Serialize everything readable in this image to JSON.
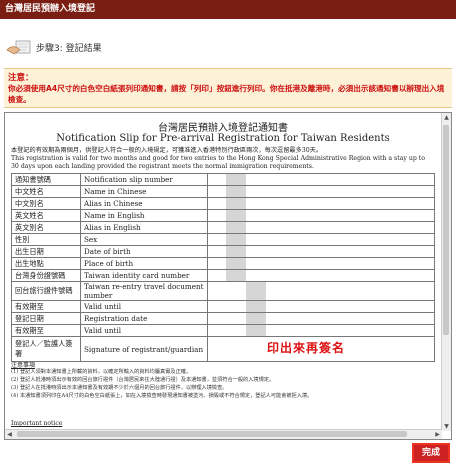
{
  "header": {
    "title": "台灣居民預辦入境登記"
  },
  "step": {
    "label": "步驟3: 登記結果"
  },
  "notice": {
    "title": "注意：",
    "text": "你必須使用A4尺寸的白色空白紙張列印通知書，請按「列印」按鈕進行列印。你在抵港及離港時，必須出示該通知書以辦理出入境檢查。"
  },
  "slip": {
    "title_cn": "台灣居民預辦入境登記通知書",
    "title_en": "Notification Slip for Pre-arrival Registration for Taiwan Residents",
    "intro_cn": "本登記的有效期為兩個月，供登記人符合一般的入境規定，可獲准進入香港特別行政區兩次，每次逗留最多30天。",
    "intro_en": "This registration is valid for two months and good for two entries to the Hong Kong Special Administrative Region with a stay up to 30 days upon each landing provided the registrant meets the normal immigration requirements.",
    "rows": [
      {
        "cn": "通知書號碼",
        "en": "Notification slip number"
      },
      {
        "cn": "中文姓名",
        "en": "Name in Chinese"
      },
      {
        "cn": "中文別名",
        "en": "Alias in Chinese"
      },
      {
        "cn": "英文姓名",
        "en": "Name in English"
      },
      {
        "cn": "英文別名",
        "en": "Alias in English"
      },
      {
        "cn": "性別",
        "en": "Sex"
      },
      {
        "cn": "出生日期",
        "en": "Date of birth"
      },
      {
        "cn": "出生地點",
        "en": "Place of birth"
      },
      {
        "cn": "台灣身份證號碼",
        "en": "Taiwan identity card number"
      },
      {
        "cn": "回台旅行證件號碼",
        "en": "Taiwan re-entry travel document number"
      },
      {
        "cn": "有效期至",
        "en": "Valid until"
      },
      {
        "cn": "登記日期",
        "en": "Registration date"
      },
      {
        "cn": "有效期至",
        "en": "Valid until"
      }
    ],
    "signature_cn": "登記人／監護人簽署",
    "signature_en": "Signature of registrant/guardian",
    "signature_note": "印出來再簽名",
    "notes_title": "注意事項",
    "notes": [
      "(1) 登記人須對本通知書上所載的資料，以確定所輸入的資料均屬真實及正確。",
      "(2) 登記人抵港時須出示有效的回台旅行證件（台灣居民來往大陸通行證）及本通知書，並須符合一般的入境規定。",
      "(3) 登記人在抵港時須出示本通知書及有效期不少於六個月的回台旅行證件，以辦理入境檢查。",
      "(4) 本通知書須列印在A4尺寸的白色空白紙張上，如在入境檢查時發現通知書被塗污、損毀或不符合規定，登記人可能會被拒入境。"
    ],
    "important_title": "Important notice"
  },
  "actions": {
    "done_label": "完成"
  }
}
